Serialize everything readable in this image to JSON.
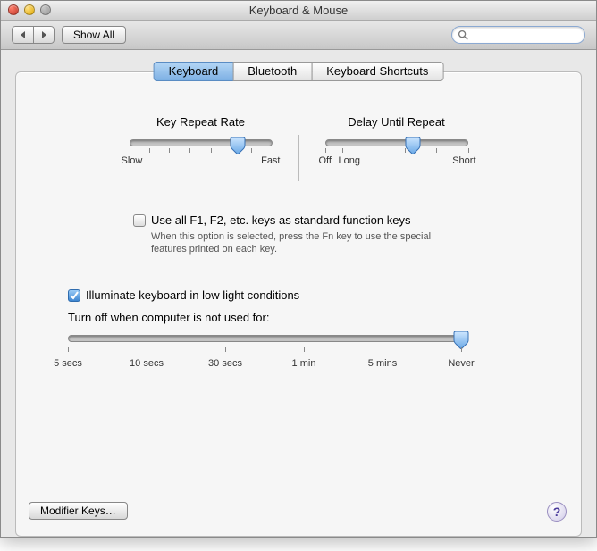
{
  "window": {
    "title": "Keyboard & Mouse"
  },
  "toolbar": {
    "show_all": "Show All",
    "search_placeholder": ""
  },
  "tabs": {
    "keyboard": "Keyboard",
    "bluetooth": "Bluetooth",
    "shortcuts": "Keyboard Shortcuts",
    "selected": "keyboard"
  },
  "key_repeat": {
    "title": "Key Repeat Rate",
    "min": "Slow",
    "max": "Fast",
    "position": 0.76
  },
  "delay_repeat": {
    "title": "Delay Until Repeat",
    "off": "Off",
    "long": "Long",
    "short": "Short",
    "position": 0.62
  },
  "fn_keys": {
    "checked": false,
    "label": "Use all F1, F2, etc. keys as standard function keys",
    "hint": "When this option is selected, press the Fn key to use the special features printed on each key."
  },
  "illuminate": {
    "checked": true,
    "label": "Illuminate keyboard in low light conditions",
    "sub": "Turn off when computer is not used for:",
    "ticks": [
      "5 secs",
      "10 secs",
      "30 secs",
      "1 min",
      "5 mins",
      "Never"
    ],
    "position": 1.0
  },
  "buttons": {
    "modifier": "Modifier Keys…"
  },
  "help": "?"
}
